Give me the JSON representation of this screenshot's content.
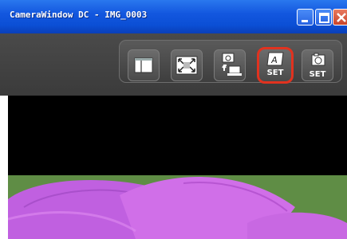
{
  "window": {
    "title": "CameraWindow DC - IMG_0003",
    "controls": [
      "minimize",
      "maximize",
      "close"
    ]
  },
  "toolbar": {
    "buttons": [
      {
        "name": "layout-button",
        "icon": "two-panel-layout-icon",
        "label": ""
      },
      {
        "name": "fullscreen-button",
        "icon": "expand-arrows-icon",
        "label": ""
      },
      {
        "name": "transfer-button",
        "icon": "camera-to-computer-icon",
        "label": ""
      },
      {
        "name": "set-my-category-button",
        "icon": "document-a-icon",
        "label": "SET",
        "highlighted": true
      },
      {
        "name": "set-camera-button",
        "icon": "camera-icon",
        "label": "SET"
      }
    ],
    "highlight_color": "#e1321f"
  },
  "viewer": {
    "background": "#000000",
    "image_subject": "pink flower petals on green background"
  }
}
